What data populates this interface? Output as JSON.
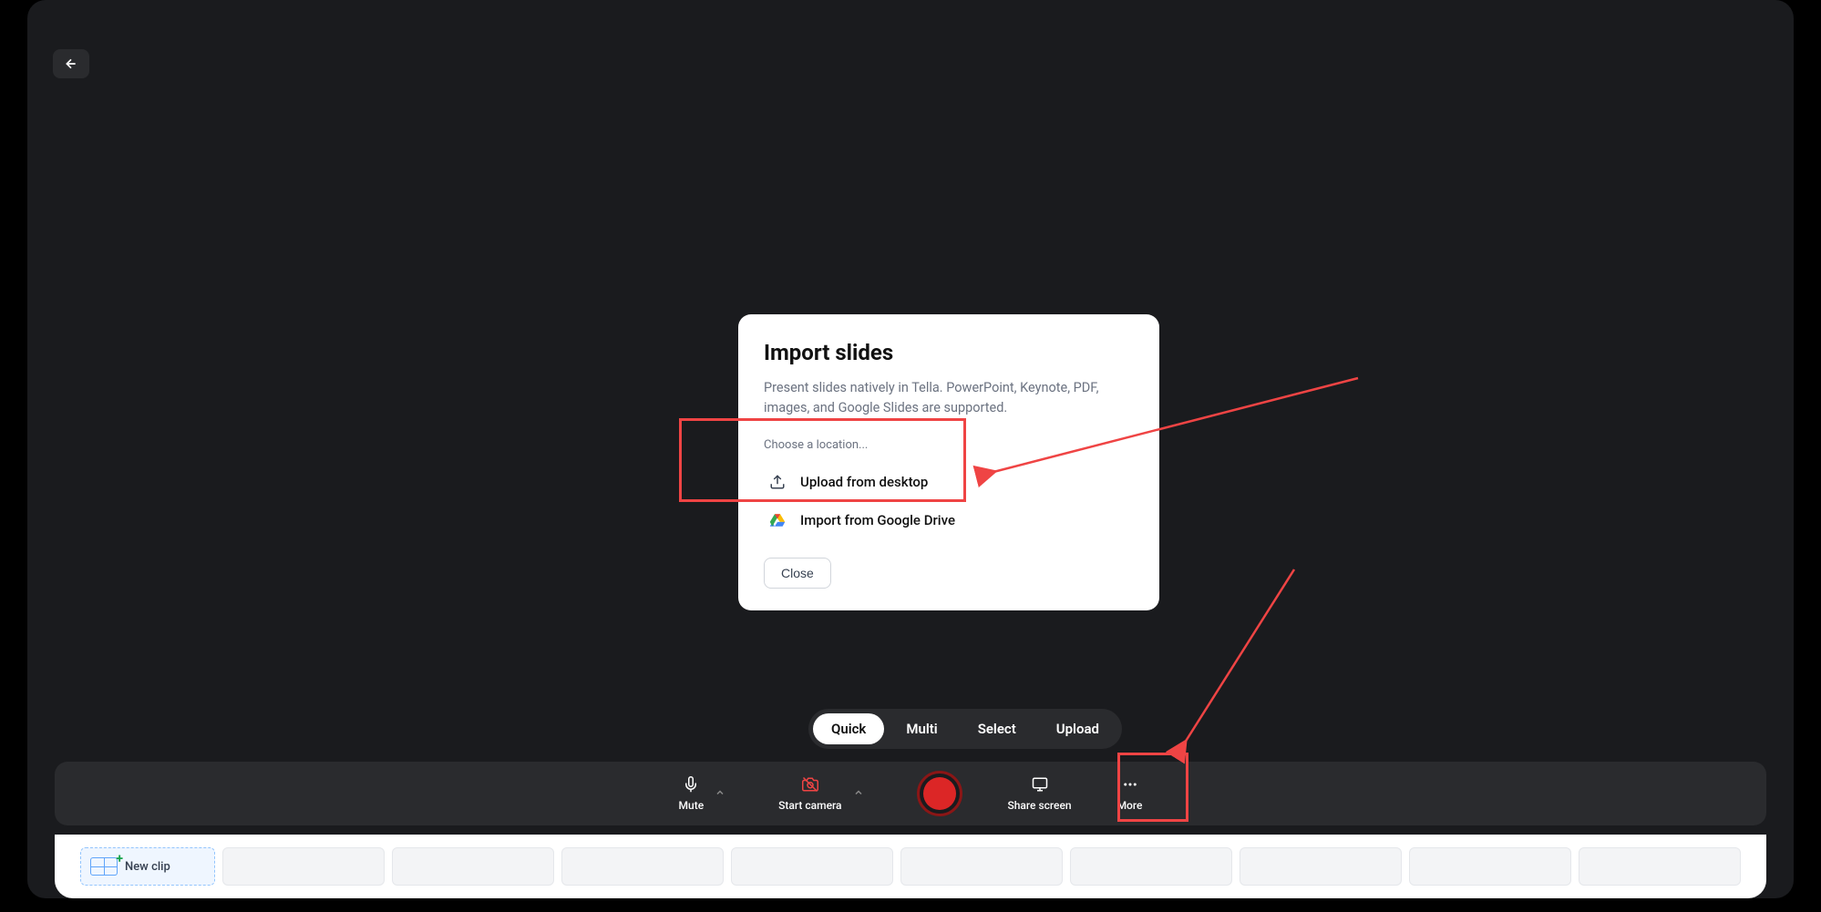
{
  "back_button": "←",
  "modal": {
    "title": "Import slides",
    "description": "Present slides natively in Tella. PowerPoint, Keynote, PDF, images, and Google Slides are supported.",
    "choose_label": "Choose a location...",
    "options": [
      {
        "label": "Upload from desktop"
      },
      {
        "label": "Import from Google Drive"
      }
    ],
    "close_label": "Close"
  },
  "modes": {
    "items": [
      "Quick",
      "Multi",
      "Select",
      "Upload"
    ],
    "active": "Quick"
  },
  "toolbar": {
    "mute_label": "Mute",
    "camera_label": "Start camera",
    "share_label": "Share screen",
    "more_label": "More"
  },
  "timeline": {
    "new_clip_label": "New clip"
  }
}
